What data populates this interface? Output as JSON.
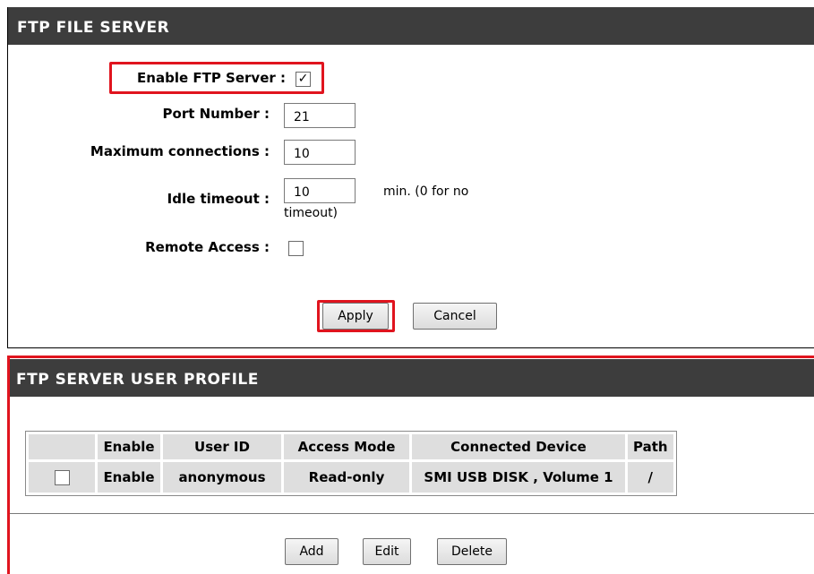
{
  "ftp": {
    "title": "FTP FILE SERVER",
    "enable_label": "Enable FTP Server :",
    "enable_checked": true,
    "port_label": "Port Number :",
    "port_value": "21",
    "maxconn_label": "Maximum connections :",
    "maxconn_value": "10",
    "idle_label": "Idle timeout :",
    "idle_value": "10",
    "idle_note1": "min. (0 for no",
    "idle_note2": "timeout)",
    "remote_label": "Remote Access :",
    "remote_checked": false,
    "apply_label": "Apply",
    "cancel_label": "Cancel"
  },
  "profile": {
    "title": "FTP SERVER USER PROFILE",
    "columns": [
      "Enable",
      "User ID",
      "Access Mode",
      "Connected Device",
      "Path"
    ],
    "rows": [
      {
        "checked": false,
        "enable": "Enable",
        "user_id": "anonymous",
        "access_mode": "Read-only",
        "device": "SMI USB DISK , Volume 1",
        "path": "/"
      }
    ],
    "add_label": "Add",
    "edit_label": "Edit",
    "delete_label": "Delete"
  },
  "colors": {
    "header_bg": "#3d3d3d",
    "highlight": "#e0141e",
    "cell_bg": "#dedede"
  }
}
